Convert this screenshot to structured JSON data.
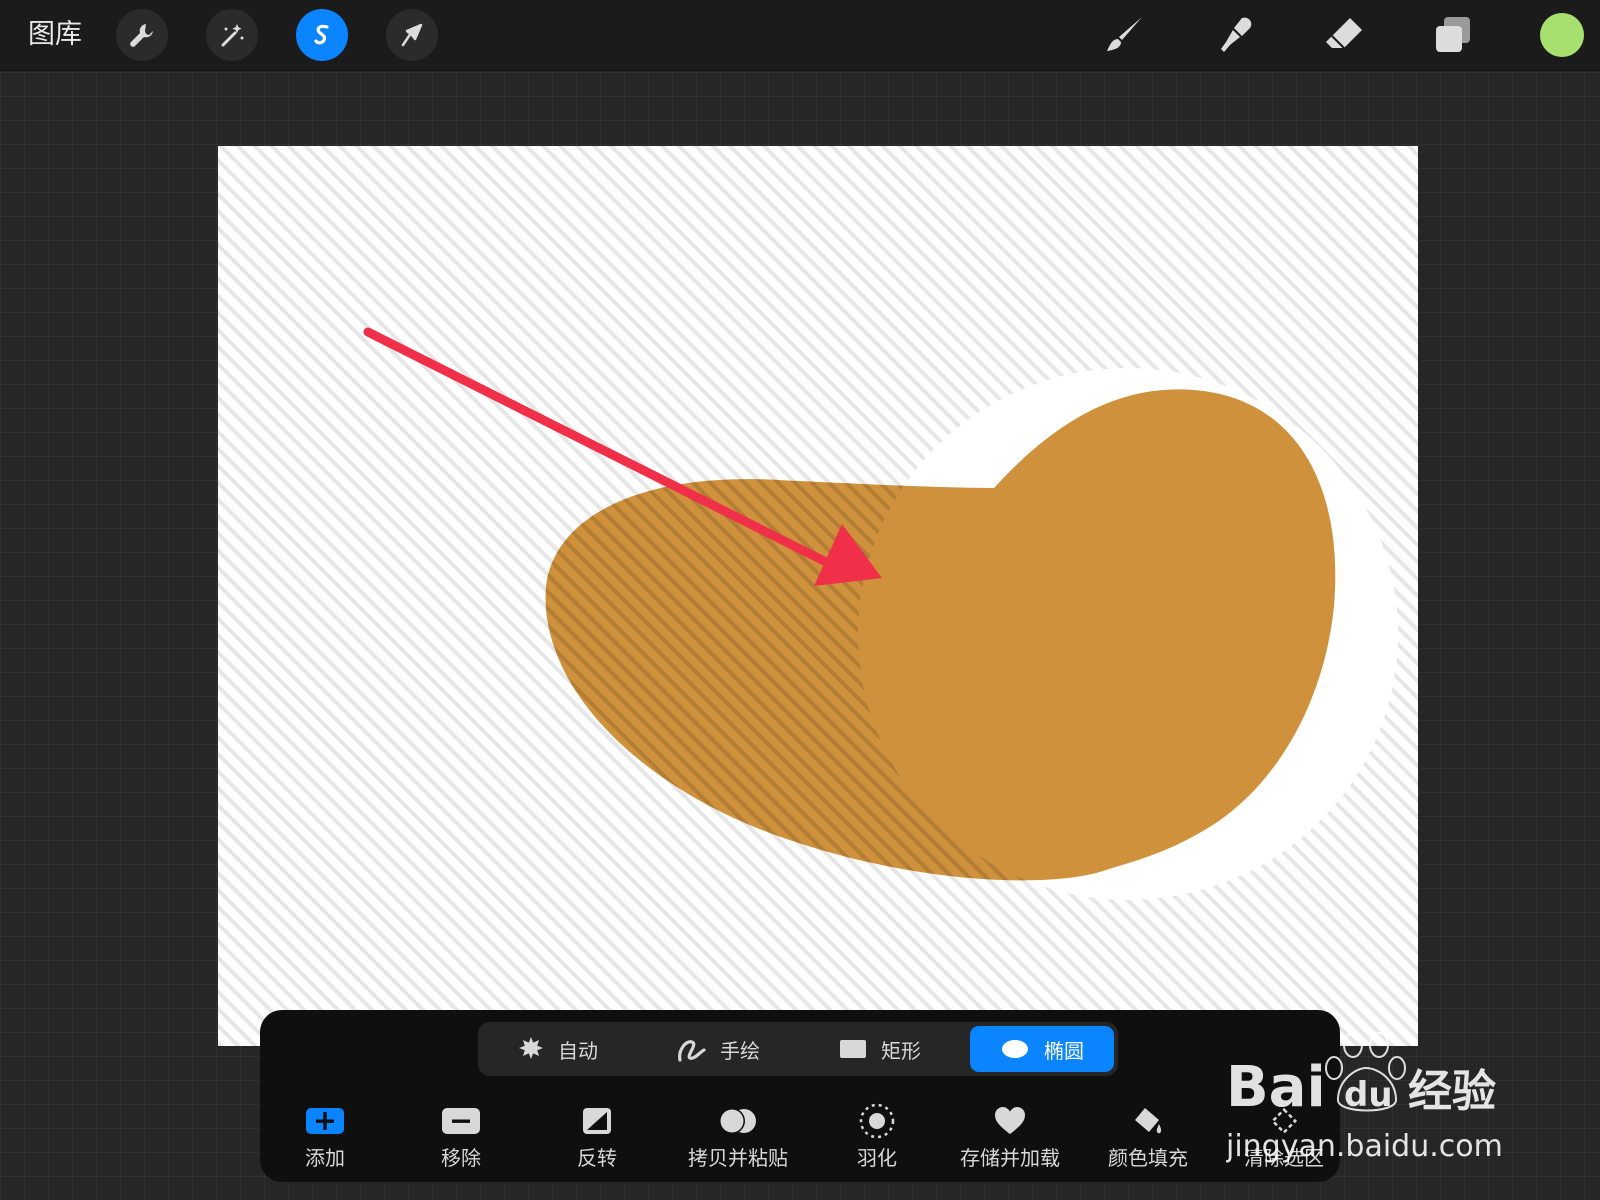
{
  "topbar": {
    "gallery_label": "图库",
    "tools_left": [
      "wrench-icon",
      "magic-wand-icon",
      "selection-icon",
      "transform-arrow-icon"
    ],
    "tools_right": [
      "brush-icon",
      "smudge-icon",
      "eraser-icon",
      "layers-icon"
    ],
    "active_tool": "selection-icon",
    "current_color": "#a8e070",
    "accent_color": "#0a84ff"
  },
  "canvas": {
    "shape_fill": "#cf913c",
    "annotation_arrow_color": "#f03048"
  },
  "selection_modes": {
    "items": [
      {
        "label": "自动",
        "icon": "auto-star-icon"
      },
      {
        "label": "手绘",
        "icon": "freehand-icon"
      },
      {
        "label": "矩形",
        "icon": "rectangle-icon"
      },
      {
        "label": "椭圆",
        "icon": "ellipse-icon"
      }
    ],
    "selected": "椭圆"
  },
  "actions": {
    "items": [
      {
        "label": "添加",
        "icon": "add-icon"
      },
      {
        "label": "移除",
        "icon": "remove-icon"
      },
      {
        "label": "反转",
        "icon": "invert-icon"
      },
      {
        "label": "拷贝并粘贴",
        "icon": "copy-paste-icon"
      },
      {
        "label": "羽化",
        "icon": "feather-icon"
      },
      {
        "label": "存储并加载",
        "icon": "save-load-heart-icon"
      },
      {
        "label": "颜色填充",
        "icon": "color-fill-icon"
      },
      {
        "label": "清除选区",
        "icon": "clear-selection-icon"
      }
    ]
  },
  "watermark": {
    "brand": "Bai",
    "brand_du": "du",
    "brand_cn": "经验",
    "domain": "jingyan.baidu.com"
  }
}
